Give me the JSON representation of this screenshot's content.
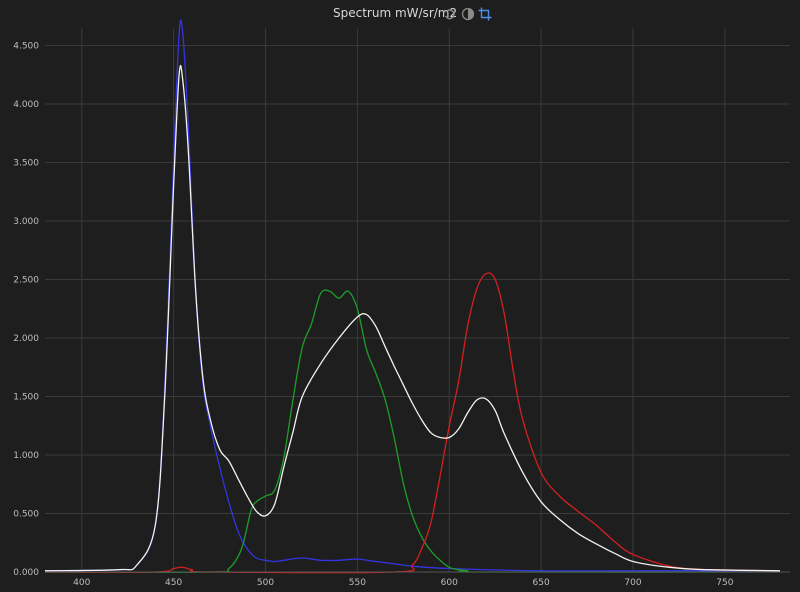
{
  "header": {
    "title": "Spectrum mW/sr/m2",
    "icons": [
      "reset-icon",
      "contrast-icon",
      "crop-icon"
    ],
    "active_icon_color": "#4a90e2",
    "icon_color": "#8a8a8a"
  },
  "colors": {
    "background": "#1e1e1e",
    "grid": "#3a3a3a",
    "axis_text": "#bdbdbd",
    "blue": "#3434e0",
    "green": "#1e9e28",
    "red": "#d42020",
    "white": "#f2f2f2"
  },
  "chart_data": {
    "type": "line",
    "title": "Spectrum mW/sr/m2",
    "xlabel": "",
    "ylabel": "",
    "xlim": [
      380,
      780
    ],
    "ylim": [
      0,
      4.65
    ],
    "grid": true,
    "x_ticks": [
      400,
      450,
      500,
      550,
      600,
      650,
      700,
      750
    ],
    "x_tick_labels": [
      "400",
      "450",
      "500",
      "550",
      "600",
      "650",
      "700",
      "750"
    ],
    "y_ticks": [
      0,
      0.5,
      1.0,
      1.5,
      2.0,
      2.5,
      3.0,
      3.5,
      4.0,
      4.5
    ],
    "y_tick_labels": [
      "0.000",
      "0.500",
      "1.000",
      "1.500",
      "2.000",
      "2.500",
      "3.000",
      "3.500",
      "4.000",
      "4.500"
    ],
    "series": [
      {
        "color": "#3434e0",
        "x": [
          380,
          420,
          430,
          440,
          445,
          450,
          453,
          455,
          458,
          462,
          466,
          470,
          475,
          480,
          485,
          490,
          495,
          500,
          505,
          510,
          520,
          530,
          540,
          550,
          560,
          570,
          580,
          600,
          650,
          700,
          780
        ],
        "y": [
          0.01,
          0.02,
          0.06,
          0.4,
          1.5,
          3.5,
          4.6,
          4.6,
          3.8,
          2.4,
          1.6,
          1.25,
          0.9,
          0.6,
          0.35,
          0.2,
          0.12,
          0.1,
          0.09,
          0.1,
          0.12,
          0.1,
          0.1,
          0.11,
          0.09,
          0.07,
          0.05,
          0.03,
          0.01,
          0.01,
          0.01
        ]
      },
      {
        "color": "#1e9e28",
        "x": [
          380,
          470,
          480,
          487,
          492,
          495,
          500,
          505,
          510,
          515,
          520,
          525,
          530,
          535,
          540,
          545,
          550,
          555,
          560,
          565,
          570,
          575,
          580,
          585,
          590,
          595,
          600,
          605,
          610,
          620,
          780
        ],
        "y": [
          0.0,
          0.0,
          0.03,
          0.2,
          0.52,
          0.6,
          0.65,
          0.7,
          0.98,
          1.48,
          1.92,
          2.12,
          2.38,
          2.4,
          2.34,
          2.4,
          2.25,
          1.9,
          1.7,
          1.48,
          1.15,
          0.76,
          0.48,
          0.3,
          0.18,
          0.1,
          0.04,
          0.02,
          0.01,
          0.0,
          0.0
        ]
      },
      {
        "color": "#d42020",
        "x": [
          380,
          440,
          450,
          455,
          460,
          470,
          570,
          580,
          585,
          590,
          595,
          600,
          605,
          610,
          615,
          620,
          625,
          630,
          635,
          640,
          650,
          660,
          670,
          680,
          690,
          700,
          720,
          740,
          780
        ],
        "y": [
          0.0,
          0.0,
          0.03,
          0.04,
          0.02,
          0.0,
          0.0,
          0.06,
          0.2,
          0.42,
          0.82,
          1.25,
          1.62,
          2.1,
          2.42,
          2.55,
          2.5,
          2.2,
          1.7,
          1.3,
          0.85,
          0.65,
          0.52,
          0.4,
          0.26,
          0.15,
          0.05,
          0.02,
          0.01
        ]
      },
      {
        "color": "#f2f2f2",
        "x": [
          380,
          420,
          430,
          440,
          445,
          450,
          453,
          455,
          458,
          462,
          466,
          470,
          475,
          480,
          485,
          490,
          495,
          500,
          505,
          510,
          515,
          520,
          530,
          540,
          550,
          555,
          560,
          565,
          570,
          575,
          580,
          585,
          590,
          595,
          600,
          605,
          610,
          615,
          620,
          625,
          630,
          640,
          650,
          660,
          670,
          680,
          690,
          700,
          720,
          740,
          780
        ],
        "y": [
          0.01,
          0.02,
          0.06,
          0.4,
          1.45,
          3.3,
          4.25,
          4.2,
          3.6,
          2.4,
          1.65,
          1.3,
          1.05,
          0.95,
          0.8,
          0.65,
          0.52,
          0.48,
          0.58,
          0.9,
          1.2,
          1.5,
          1.78,
          2.0,
          2.18,
          2.2,
          2.1,
          1.93,
          1.76,
          1.6,
          1.44,
          1.3,
          1.19,
          1.15,
          1.15,
          1.22,
          1.36,
          1.47,
          1.48,
          1.38,
          1.18,
          0.85,
          0.6,
          0.45,
          0.33,
          0.24,
          0.16,
          0.09,
          0.04,
          0.02,
          0.01
        ]
      }
    ]
  }
}
